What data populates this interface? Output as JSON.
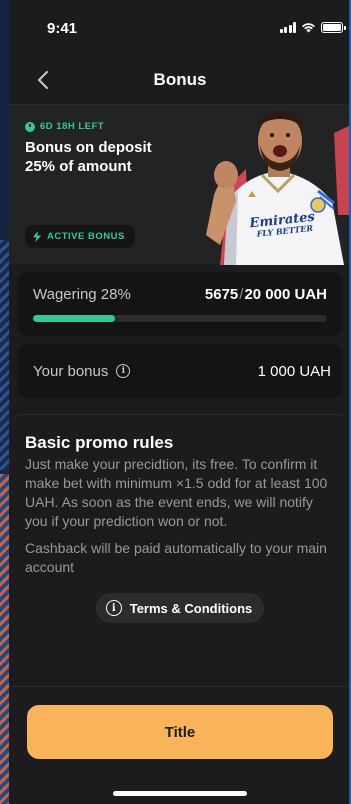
{
  "status": {
    "time": "9:41"
  },
  "nav": {
    "title": "Bonus"
  },
  "hero": {
    "timer": "6D 18H LEFT",
    "title_line1": "Bonus on deposit",
    "title_line2": "25% of amount",
    "badge": "ACTIVE BONUS",
    "player_shirt_text1": "Emirates",
    "player_shirt_text2": "FLY BETTER"
  },
  "wagering": {
    "label": "Wagering 28%",
    "current": "5675",
    "separator": "/",
    "total": "20 000 UAH",
    "progress": 0.28
  },
  "bonus": {
    "label": "Your bonus",
    "value": "1 000 UAH"
  },
  "rules": {
    "title": "Basic promo rules",
    "text1": "Just make your precidtion, its free. To confirm it make bet with minimum ×1.5 odd for at least 100 UAH. As soon as the event ends, we will notify you if your prediction won or not.",
    "text2": "Cashback will be paid automatically to your main account"
  },
  "terms": {
    "label": "Terms & Conditions"
  },
  "cta": {
    "label": "Title"
  },
  "colors": {
    "accent": "#34c79a",
    "cta": "#f9b35a",
    "background": "#1c1c1e"
  }
}
